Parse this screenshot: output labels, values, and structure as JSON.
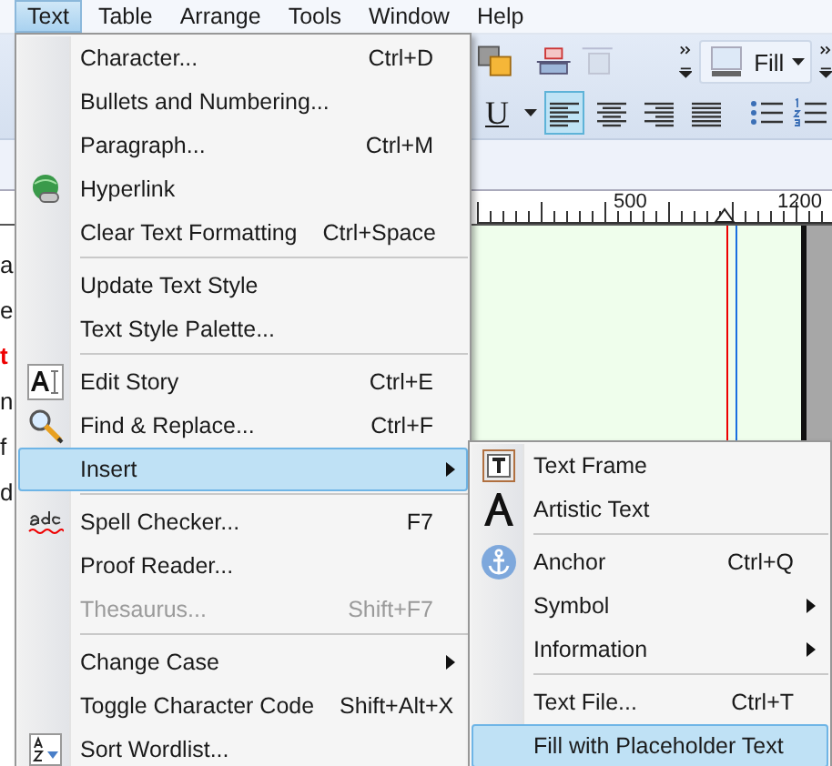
{
  "menubar": [
    {
      "label": "Text",
      "selected": true
    },
    {
      "label": "Table",
      "selected": false
    },
    {
      "label": "Arrange",
      "selected": false
    },
    {
      "label": "Tools",
      "selected": false
    },
    {
      "label": "Window",
      "selected": false
    },
    {
      "label": "Help",
      "selected": false
    }
  ],
  "toolbar": {
    "fill_button": {
      "label": "Fill"
    },
    "underline_button": {
      "label": "U"
    },
    "alignment": [
      {
        "selected": true
      },
      {
        "selected": false
      },
      {
        "selected": false
      },
      {
        "selected": false
      }
    ]
  },
  "ruler": {
    "labels": [
      "500",
      "1200"
    ]
  },
  "document_edge": {
    "fragments": [
      "a",
      "e",
      "t",
      "n",
      "f",
      "d"
    ]
  },
  "text_menu": [
    {
      "kind": "item",
      "label": "Character...",
      "shortcut": "Ctrl+D",
      "submenu": false,
      "disabled": false,
      "selected": false
    },
    {
      "kind": "item",
      "label": "Bullets and Numbering...",
      "submenu": false,
      "disabled": false,
      "selected": false
    },
    {
      "kind": "item",
      "label": "Paragraph...",
      "shortcut": "Ctrl+M",
      "submenu": false,
      "disabled": false,
      "selected": false
    },
    {
      "kind": "item",
      "label": "Hyperlink",
      "submenu": false,
      "disabled": false,
      "selected": false
    },
    {
      "kind": "item",
      "label": "Clear Text Formatting",
      "shortcut": "Ctrl+Space",
      "submenu": false,
      "disabled": false,
      "selected": false
    },
    {
      "kind": "separator"
    },
    {
      "kind": "item",
      "label": "Update Text Style",
      "submenu": false,
      "disabled": false,
      "selected": false
    },
    {
      "kind": "item",
      "label": "Text Style Palette...",
      "submenu": false,
      "disabled": false,
      "selected": false
    },
    {
      "kind": "separator"
    },
    {
      "kind": "item",
      "label": "Edit Story",
      "shortcut": "Ctrl+E",
      "submenu": false,
      "disabled": false,
      "selected": false
    },
    {
      "kind": "item",
      "label": "Find & Replace...",
      "shortcut": "Ctrl+F",
      "submenu": false,
      "disabled": false,
      "selected": false
    },
    {
      "kind": "item",
      "label": "Insert",
      "submenu": true,
      "disabled": false,
      "selected": true
    },
    {
      "kind": "separator"
    },
    {
      "kind": "item",
      "label": "Spell Checker...",
      "shortcut": "F7",
      "submenu": false,
      "disabled": false,
      "selected": false
    },
    {
      "kind": "item",
      "label": "Proof Reader...",
      "submenu": false,
      "disabled": false,
      "selected": false
    },
    {
      "kind": "item",
      "label": "Thesaurus...",
      "shortcut": "Shift+F7",
      "submenu": false,
      "disabled": true,
      "selected": false
    },
    {
      "kind": "separator"
    },
    {
      "kind": "item",
      "label": "Change Case",
      "submenu": true,
      "disabled": false,
      "selected": false
    },
    {
      "kind": "item",
      "label": "Toggle Character Code",
      "shortcut": "Shift+Alt+X",
      "submenu": false,
      "disabled": false,
      "selected": false
    },
    {
      "kind": "item",
      "label": "Sort Wordlist...",
      "submenu": false,
      "disabled": false,
      "selected": false
    }
  ],
  "insert_submenu": [
    {
      "kind": "item",
      "label": "Text Frame",
      "submenu": false,
      "disabled": false,
      "selected": false
    },
    {
      "kind": "item",
      "label": "Artistic Text",
      "submenu": false,
      "disabled": false,
      "selected": false
    },
    {
      "kind": "separator"
    },
    {
      "kind": "item",
      "label": "Anchor",
      "shortcut": "Ctrl+Q",
      "submenu": false,
      "disabled": false,
      "selected": false
    },
    {
      "kind": "item",
      "label": "Symbol",
      "submenu": true,
      "disabled": false,
      "selected": false
    },
    {
      "kind": "item",
      "label": "Information",
      "submenu": true,
      "disabled": false,
      "selected": false
    },
    {
      "kind": "separator"
    },
    {
      "kind": "item",
      "label": "Text File...",
      "shortcut": "Ctrl+T",
      "submenu": false,
      "disabled": false,
      "selected": false
    },
    {
      "kind": "item",
      "label": "Fill with Placeholder Text",
      "submenu": false,
      "disabled": false,
      "selected": true
    }
  ]
}
